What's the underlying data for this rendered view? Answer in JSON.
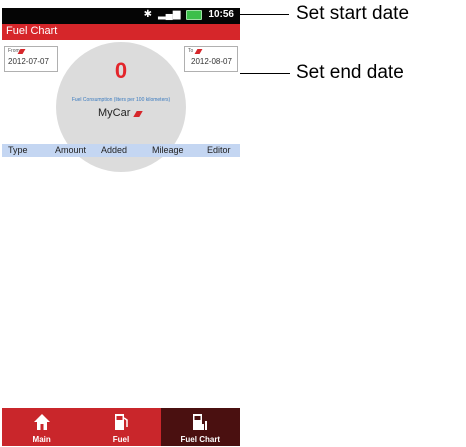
{
  "annotations": {
    "start": "Set start date",
    "end": "Set end date"
  },
  "status": {
    "time": "10:56"
  },
  "app": {
    "title": "Fuel Chart"
  },
  "from": {
    "label": "From",
    "date": "2012-07-07"
  },
  "to": {
    "label": "To",
    "date": "2012-08-07"
  },
  "gauge": {
    "value": "0",
    "caption": "Fuel Consumption (liters per 100 kilometers)"
  },
  "car": {
    "name": "MyCar"
  },
  "columns": [
    "Type",
    "Amount",
    "Added",
    "Mileage",
    "Editor"
  ],
  "tabs": [
    "Main",
    "Fuel",
    "Fuel Chart"
  ],
  "colors": {
    "accent": "#d6262a",
    "active_tab": "#4a1010",
    "header_row": "#c4d6f2"
  }
}
